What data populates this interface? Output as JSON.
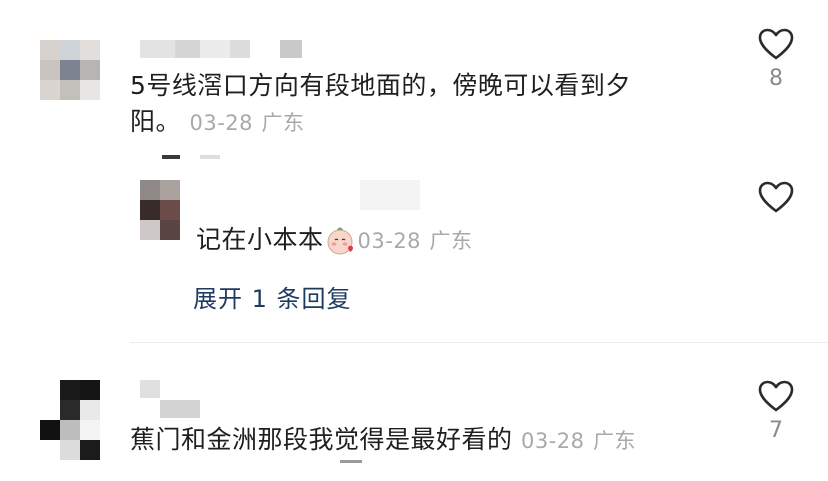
{
  "comments": [
    {
      "text": "5号线滘口方向有段地面的，傍晚可以看到夕",
      "text_cont": "阳。",
      "date": "03-28",
      "location": "广东",
      "likes": "8"
    },
    {
      "text": "记在小本本",
      "emoji": "blush-heart-emoji",
      "date": "03-28",
      "location": "广东",
      "expand_label": "展开 1 条回复"
    },
    {
      "text": "蕉门和金洲那段我觉得是最好看的",
      "date": "03-28",
      "location": "广东",
      "likes": "7"
    }
  ],
  "icons": {
    "like": "heart-outline-icon"
  },
  "colors": {
    "text": "#1f1f1f",
    "meta": "#a9a9a9",
    "link": "#1e3a5f",
    "divider": "#ececec"
  }
}
